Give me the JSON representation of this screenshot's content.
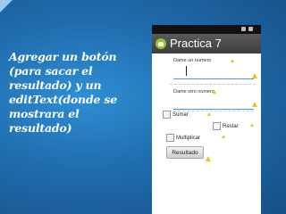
{
  "slide": {
    "lines": [
      "Agregar un botón",
      "(para sacar el",
      "resultado) y un",
      "editText(donde se",
      "mostrara el",
      "resultado)"
    ],
    "accent_color": "#9cc9ef",
    "text_color": "#ffffff"
  },
  "app": {
    "title": "Practica 7",
    "icon": "android-icon",
    "titlebar_color": "#4a4a4a"
  },
  "form": {
    "label1": "Dame un numero",
    "label2": "Dame otro numero",
    "checkboxes": [
      {
        "label": "Sumar",
        "checked": false
      },
      {
        "label": "Restar",
        "checked": false
      },
      {
        "label": "Multiplicar",
        "checked": false
      }
    ],
    "button_label": "Resultado",
    "accent_color": "#4a9ad6",
    "warning_color": "#f0c419"
  }
}
